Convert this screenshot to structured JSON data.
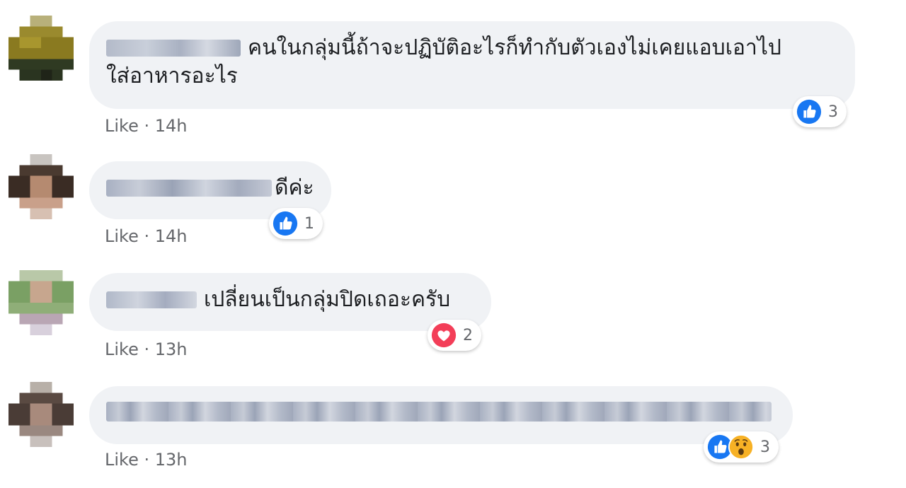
{
  "comments": [
    {
      "author": "",
      "text_line1": "คนในกลุ่มนี้ถ้าจะปฏิบัติอะไรก็ทำกับตัวเองไม่เคยแอบเอาไป",
      "text_line2": "ใส่อาหารอะไร",
      "reactions": [
        "like-icon"
      ],
      "reaction_count": "3",
      "like_label": "Like",
      "separator": " · ",
      "time": "14h"
    },
    {
      "author": "",
      "text_line1": "ดีค่ะ",
      "reactions": [
        "like-icon"
      ],
      "reaction_count": "1",
      "like_label": "Like",
      "separator": " · ",
      "time": "14h"
    },
    {
      "author": "",
      "text_line1": "เปลี่ยนเป็นกลุ่มปิดเถอะครับ",
      "reactions": [
        "love-icon"
      ],
      "reaction_count": "2",
      "like_label": "Like",
      "separator": " · ",
      "time": "13h"
    },
    {
      "author": "",
      "text_line1": "",
      "reactions": [
        "like-icon",
        "wow-icon"
      ],
      "reaction_count": "3",
      "like_label": "Like",
      "separator": " · ",
      "time": "13h"
    }
  ],
  "colors": {
    "bubble": "#f0f2f5",
    "like": "#1877f2",
    "love": "#f33e58",
    "wow": "#f7b125",
    "meta_text": "#65676b"
  }
}
